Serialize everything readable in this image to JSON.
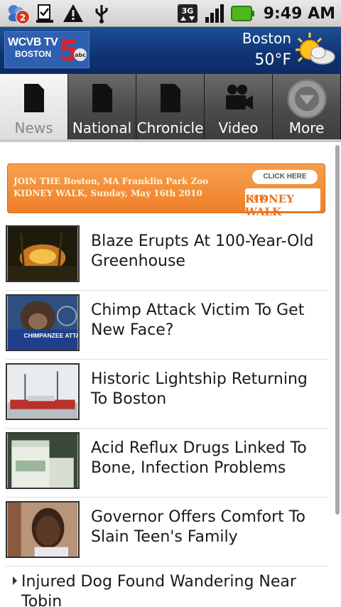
{
  "status_bar": {
    "notification_count": "2",
    "network": "3G",
    "time": "9:49 AM"
  },
  "header": {
    "logo_text": "WCVB TV",
    "logo_sub": "BOSTON",
    "logo_channel": "5",
    "logo_network": "abc",
    "city": "Boston",
    "temperature": "50°F"
  },
  "tabs": [
    {
      "label": "News",
      "icon": "document-icon",
      "active": true
    },
    {
      "label": "National",
      "icon": "document-icon",
      "active": false
    },
    {
      "label": "Chronicle",
      "icon": "document-icon",
      "active": false
    },
    {
      "label": "Video",
      "icon": "video-camera-icon",
      "active": false
    },
    {
      "label": "More",
      "icon": "chevron-down-icon",
      "active": false
    }
  ],
  "banner": {
    "text": "JOIN THE Boston, MA Franklin Park Zoo KIDNEY WALK, Sunday, May 16th 2010",
    "click_label": "CLICK HERE",
    "logo_year": "2010",
    "logo_name": "KIDNEY WALK"
  },
  "news": [
    {
      "title": "Blaze Erupts At 100-Year-Old Greenhouse",
      "thumb": "fire-photo"
    },
    {
      "title": "Chimp Attack Victim To Get New Face?",
      "thumb": "chimp-photo",
      "thumb_caption": "CHIMPANZEE ATTACK"
    },
    {
      "title": "Historic Lightship Returning To Boston",
      "thumb": "ship-photo"
    },
    {
      "title": "Acid Reflux Drugs Linked To Bone, Infection Problems",
      "thumb": "bottles-photo"
    },
    {
      "title": "Governor Offers Comfort To Slain Teen's Family",
      "thumb": "teen-photo"
    }
  ],
  "text_items": [
    {
      "title": "Injured Dog Found Wandering Near Tobin"
    }
  ]
}
